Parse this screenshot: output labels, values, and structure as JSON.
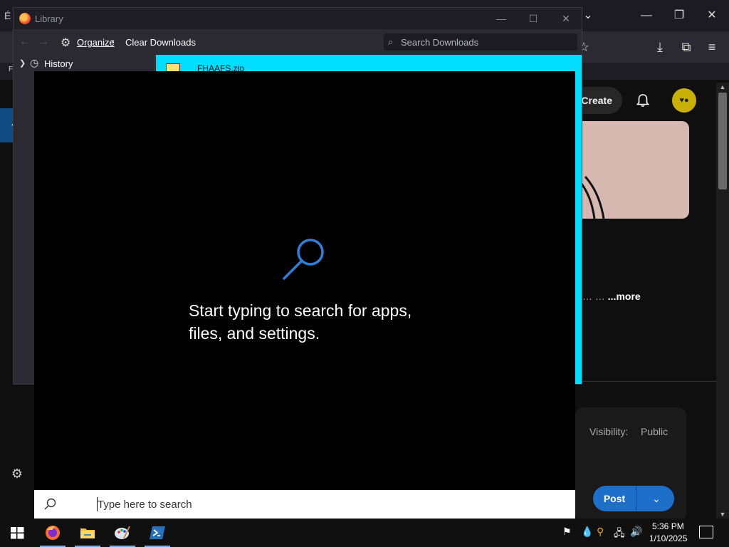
{
  "browser": {
    "left_stub": "É",
    "left_stub2": "F",
    "create_label": "Create",
    "avatar_text": "♥●",
    "more_prefix": "… …",
    "more_label": "...more",
    "visibility_label": "Visibility:",
    "visibility_value": "Public",
    "post_label": "Post"
  },
  "library": {
    "title": "Library",
    "organize_label": "Organize",
    "clear_downloads_label": "Clear Downloads",
    "search_placeholder": "Search Downloads",
    "tree_items": [
      {
        "label": "History"
      }
    ],
    "downloads": [
      {
        "filename": "FHAAFS.zip"
      }
    ]
  },
  "start_search": {
    "hint_line1": "Start typing to search for apps,",
    "hint_line2": "files, and settings.",
    "placeholder": "Type here to search"
  },
  "taskbar": {
    "apps": [
      "start",
      "firefox",
      "file-explorer",
      "paint",
      "powershell"
    ],
    "time": "5:36 PM",
    "date": "1/10/2025"
  },
  "colors": {
    "accent": "#1e6fc9",
    "library_selection": "#00ddff",
    "search_panel_bg": "#000000"
  }
}
